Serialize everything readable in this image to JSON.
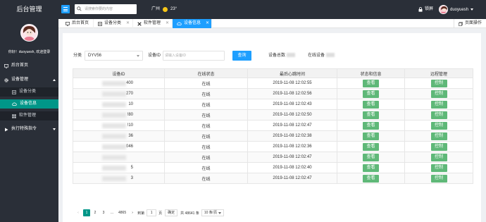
{
  "app": {
    "title": "后台管理"
  },
  "header": {
    "search_placeholder": "请搜索你要的内容",
    "weather": {
      "city": "广州",
      "temp": "23°"
    },
    "lock_label": "锁屏",
    "username": "duoyuesh"
  },
  "sidebar": {
    "welcome": "你好！duoyuesh, 欢迎登录",
    "items": [
      {
        "label": "后台首页",
        "icon": "monitor-icon"
      },
      {
        "label": "设备管理",
        "icon": "gear-icon"
      },
      {
        "label": "设备分类",
        "icon": "list-icon"
      },
      {
        "label": "设备信息",
        "icon": "cloud-icon"
      },
      {
        "label": "软件管理",
        "icon": "grid-icon"
      },
      {
        "label": "执行特殊指令",
        "icon": "play-icon"
      }
    ]
  },
  "tabs": [
    {
      "label": "后台首页"
    },
    {
      "label": "设备分类"
    },
    {
      "label": "软件管理"
    },
    {
      "label": "设备信息"
    }
  ],
  "page_ops_label": "页面操作",
  "filter": {
    "category_label": "分类",
    "category_value": "DYV56",
    "device_id_label": "设备ID",
    "device_id_placeholder": "请输入设备ID",
    "query_label": "查询",
    "total_label": "设备总数",
    "online_label": "在线设备"
  },
  "table": {
    "headers": [
      "设备ID",
      "在线状态",
      "最后心跳时间",
      "状态和信息",
      "远程管理"
    ],
    "view_label": "查看",
    "control_label": "控制",
    "rows": [
      {
        "id_suffix": "400",
        "status": "在线",
        "time": "2019-11-08 12:02:55"
      },
      {
        "id_suffix": "270",
        "status": "在线",
        "time": "2019-11-08 12:02:56"
      },
      {
        "id_suffix": "10",
        "status": "在线",
        "time": "2019-11-08 12:02:43"
      },
      {
        "id_suffix": "!80",
        "status": "在线",
        "time": "2019-11-08 12:02:50"
      },
      {
        "id_suffix": "!10",
        "status": "在线",
        "time": "2019-11-08 12:02:47"
      },
      {
        "id_suffix": "36",
        "status": "在线",
        "time": "2019-11-08 12:02:38"
      },
      {
        "id_suffix": "046",
        "status": "在线",
        "time": "2019-11-08 12:02:36"
      },
      {
        "id_suffix": "",
        "status": "在线",
        "time": "2019-11-08 12:02:47"
      },
      {
        "id_suffix": "5",
        "status": "在线",
        "time": "2019-11-08 12:02:40"
      },
      {
        "id_suffix": "3",
        "status": "在线",
        "time": "2019-11-08 12:02:47"
      }
    ]
  },
  "pagination": {
    "prev": "‹",
    "pages": [
      "1",
      "2",
      "3"
    ],
    "ellipsis": "…",
    "last_page": "4865",
    "next": "›",
    "goto_label": "到第",
    "goto_value": "1",
    "page_unit": "页",
    "confirm_label": "确定",
    "total_text": "共 48641 条",
    "page_size": "10 条/页"
  },
  "colors": {
    "sidebar_bg": "#2a2f38",
    "accent_blue": "#1e9fff",
    "accent_teal": "#009688",
    "button_green": "#5fb878"
  }
}
